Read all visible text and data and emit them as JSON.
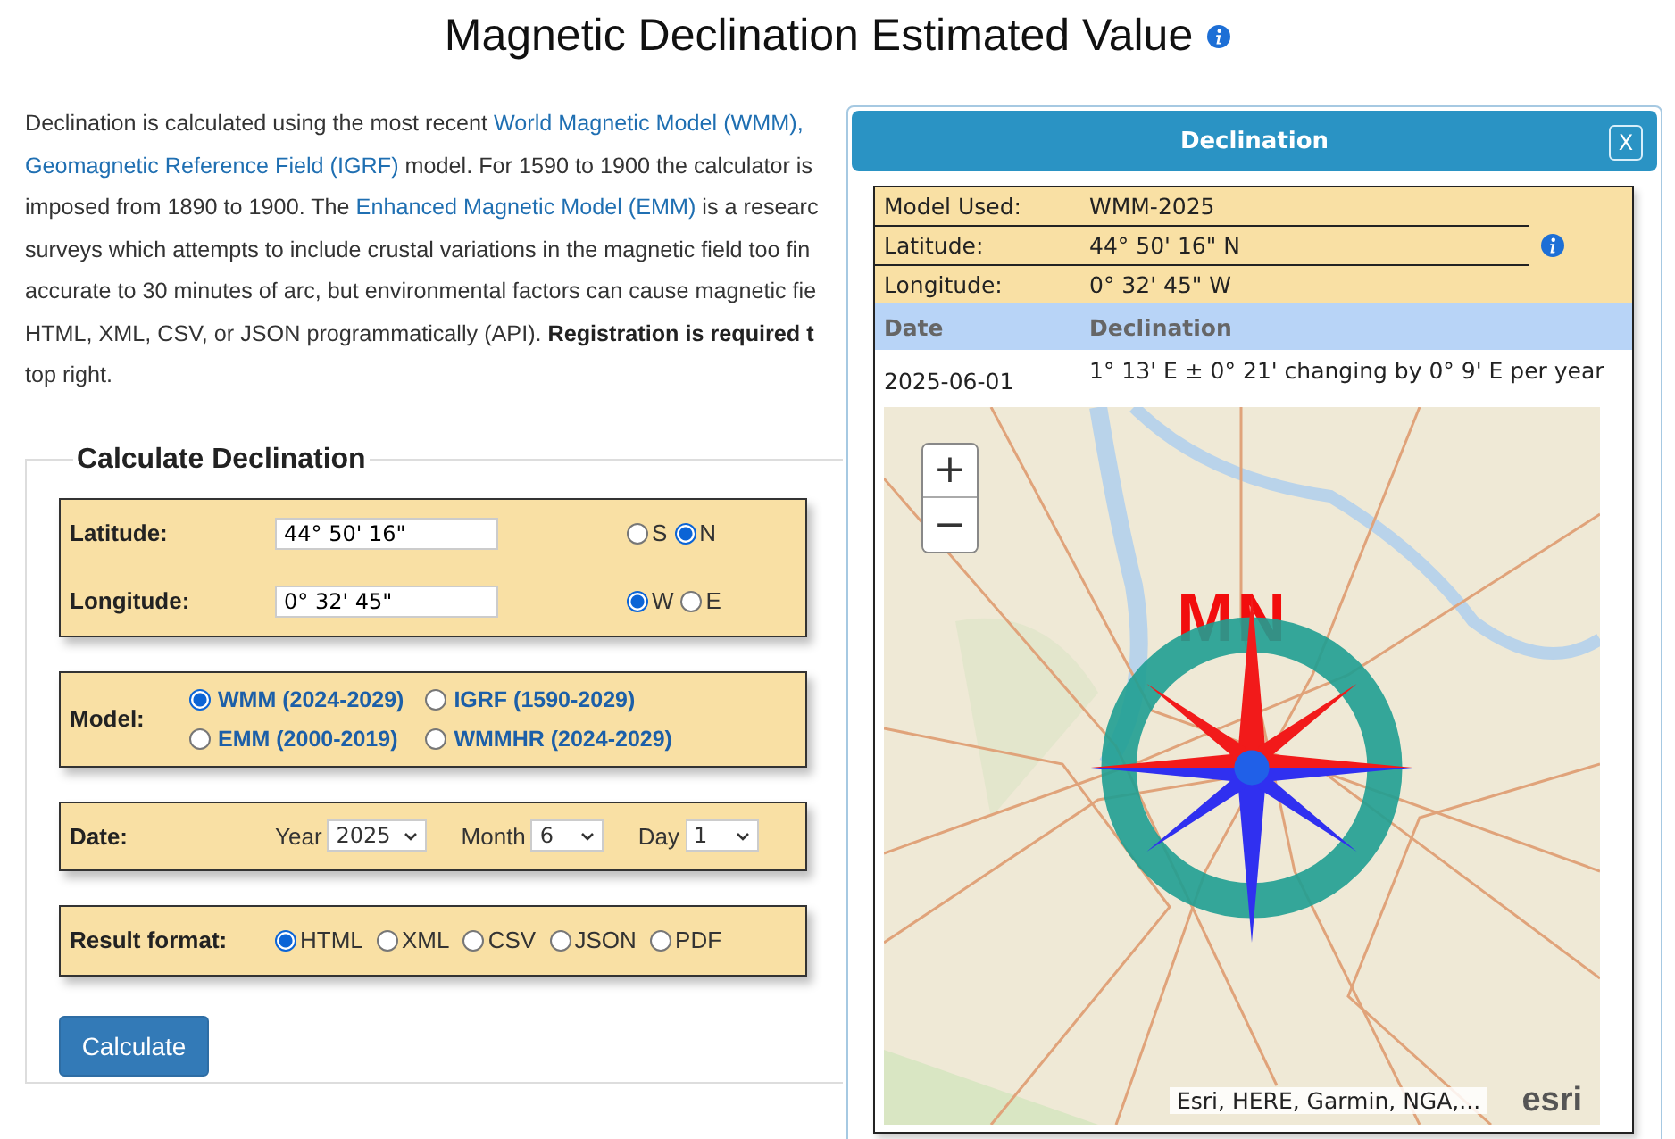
{
  "page_title": "Magnetic Declination Estimated Value",
  "intro": {
    "lines": [
      [
        {
          "kind": "text",
          "text": "Declination is calculated using the most recent "
        },
        {
          "kind": "link",
          "text": "World Magnetic Model (WMM),"
        }
      ],
      [
        {
          "kind": "link",
          "text": "Geomagnetic Reference Field (IGRF)"
        },
        {
          "kind": "text",
          "text": " model. For 1590 to 1900 the calculator is"
        }
      ],
      [
        {
          "kind": "text",
          "text": "imposed from 1890 to 1900. The "
        },
        {
          "kind": "link",
          "text": "Enhanced Magnetic Model (EMM)"
        },
        {
          "kind": "text",
          "text": " is a researc"
        }
      ],
      [
        {
          "kind": "text",
          "text": "surveys which attempts to include crustal variations in the magnetic field too fin"
        }
      ],
      [
        {
          "kind": "text",
          "text": "accurate to 30 minutes of arc, but environmental factors can cause magnetic fie"
        }
      ],
      [
        {
          "kind": "text",
          "text": "HTML, XML, CSV, or JSON programmatically (API). "
        },
        {
          "kind": "bold",
          "text": "Registration is required t"
        }
      ],
      [
        {
          "kind": "text",
          "text": "top right."
        }
      ]
    ]
  },
  "form": {
    "legend": "Calculate Declination",
    "latitude": {
      "label": "Latitude:",
      "value": "44° 50' 16\"",
      "options": [
        {
          "label": "S",
          "selected": false
        },
        {
          "label": "N",
          "selected": true
        }
      ]
    },
    "longitude": {
      "label": "Longitude:",
      "value": "0° 32' 45\"",
      "options": [
        {
          "label": "W",
          "selected": true
        },
        {
          "label": "E",
          "selected": false
        }
      ]
    },
    "model": {
      "label": "Model:",
      "options": [
        {
          "label": "WMM (2024-2029)",
          "selected": true
        },
        {
          "label": "IGRF (1590-2029)",
          "selected": false
        },
        {
          "label": "EMM (2000-2019)",
          "selected": false
        },
        {
          "label": "WMMHR (2024-2029)",
          "selected": false
        }
      ]
    },
    "date": {
      "label": "Date:",
      "fields": [
        {
          "label": "Year",
          "value": "2025"
        },
        {
          "label": "Month",
          "value": "6"
        },
        {
          "label": "Day",
          "value": "1"
        }
      ]
    },
    "result_format": {
      "label": "Result format:",
      "options": [
        {
          "label": "HTML",
          "selected": true
        },
        {
          "label": "XML",
          "selected": false
        },
        {
          "label": "CSV",
          "selected": false
        },
        {
          "label": "JSON",
          "selected": false
        },
        {
          "label": "PDF",
          "selected": false
        }
      ]
    },
    "calculate_button": "Calculate"
  },
  "dialog": {
    "title": "Declination",
    "close_label": "X",
    "info": [
      {
        "label": "Model Used:",
        "value": "WMM-2025"
      },
      {
        "label": "Latitude:",
        "value": "44° 50' 16\" N"
      },
      {
        "label": "Longitude:",
        "value": "0° 32' 45\" W"
      }
    ],
    "columns": [
      "Date",
      "Declination"
    ],
    "rows": [
      {
        "date": "2025-06-01",
        "declination": "1° 13' E  ± 0° 21'  changing by  0° 9' E per year"
      }
    ],
    "map": {
      "zoom_in": "+",
      "zoom_out": "−",
      "compass_label": "MN",
      "attribution": "Esri, HERE, Garmin, NGA,...",
      "logo": "esri"
    }
  }
}
